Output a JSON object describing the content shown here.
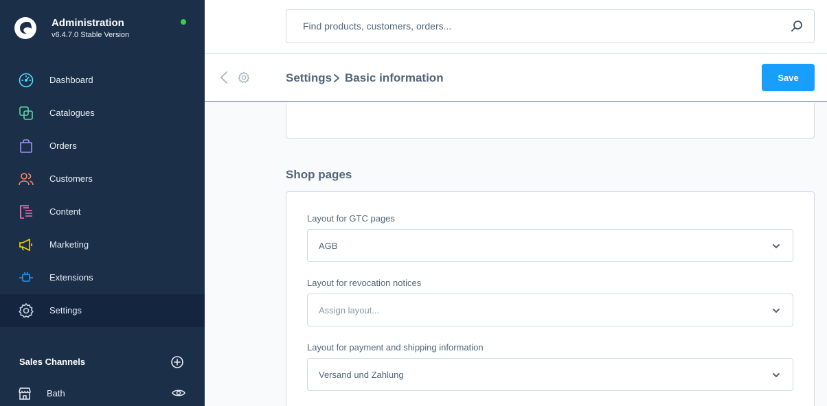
{
  "app": {
    "title": "Administration",
    "version": "v6.4.7.0 Stable Version"
  },
  "sidebar": {
    "items": [
      {
        "label": "Dashboard",
        "icon": "dashboard-icon",
        "color": "#57d9ff"
      },
      {
        "label": "Catalogues",
        "icon": "catalogue-icon",
        "color": "#57d9a3"
      },
      {
        "label": "Orders",
        "icon": "orders-icon",
        "color": "#a092f0"
      },
      {
        "label": "Customers",
        "icon": "customers-icon",
        "color": "#f88962"
      },
      {
        "label": "Content",
        "icon": "content-icon",
        "color": "#ff68b4"
      },
      {
        "label": "Marketing",
        "icon": "marketing-icon",
        "color": "#ffd700"
      },
      {
        "label": "Extensions",
        "icon": "extensions-icon",
        "color": "#189eff"
      },
      {
        "label": "Settings",
        "icon": "settings-icon",
        "color": "#9aa8b5",
        "active": true
      }
    ],
    "sales_channels": {
      "title": "Sales Channels",
      "items": [
        {
          "label": "Bath",
          "icon": "storefront-icon"
        }
      ]
    }
  },
  "search": {
    "placeholder": "Find products, customers, orders..."
  },
  "smartbar": {
    "breadcrumb_parent": "Settings",
    "breadcrumb_current": "Basic information",
    "save_label": "Save"
  },
  "shop_pages": {
    "title": "Shop pages",
    "fields": [
      {
        "label": "Layout for GTC pages",
        "value": "AGB",
        "placeholder": false
      },
      {
        "label": "Layout for revocation notices",
        "value": "Assign layout...",
        "placeholder": true
      },
      {
        "label": "Layout for payment and shipping information",
        "value": "Versand und Zahlung",
        "placeholder": false
      }
    ]
  },
  "colors": {
    "sidebar_bg": "#1b2f49",
    "accent": "#189eff",
    "status_online": "#37d046"
  }
}
